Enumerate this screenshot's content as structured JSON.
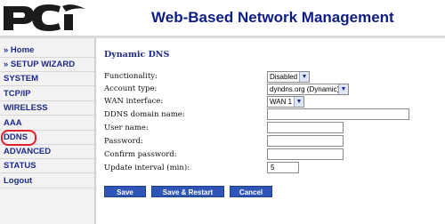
{
  "header": {
    "logo_text": "PCi",
    "title": "Web-Based Network Management"
  },
  "sidebar": {
    "items": [
      {
        "label": "» Home"
      },
      {
        "label": "» SETUP WIZARD"
      },
      {
        "label": "SYSTEM"
      },
      {
        "label": "TCP/IP"
      },
      {
        "label": "WIRELESS"
      },
      {
        "label": "AAA"
      },
      {
        "label": "DDNS"
      },
      {
        "label": "ADVANCED"
      },
      {
        "label": "STATUS"
      },
      {
        "label": "Logout"
      }
    ],
    "active": "DDNS"
  },
  "main": {
    "title": "Dynamic DNS",
    "fields": {
      "functionality": {
        "label": "Functionality:",
        "value": "Disabled"
      },
      "account_type": {
        "label": "Account type:",
        "value": "dyndns.org (Dynamic)"
      },
      "wan_interface": {
        "label": "WAN interface:",
        "value": "WAN 1"
      },
      "domain_name": {
        "label": "DDNS domain name:",
        "value": ""
      },
      "user_name": {
        "label": "User name:",
        "value": ""
      },
      "password": {
        "label": "Password:",
        "value": ""
      },
      "confirm_password": {
        "label": "Confirm password:",
        "value": ""
      },
      "update_interval": {
        "label": "Update interval (min):",
        "value": "5"
      }
    },
    "buttons": {
      "save": "Save",
      "save_restart": "Save & Restart",
      "cancel": "Cancel"
    }
  },
  "colors": {
    "accent": "#1d2a8c",
    "button": "#2f56b6",
    "highlight_ring": "#e0202a"
  }
}
